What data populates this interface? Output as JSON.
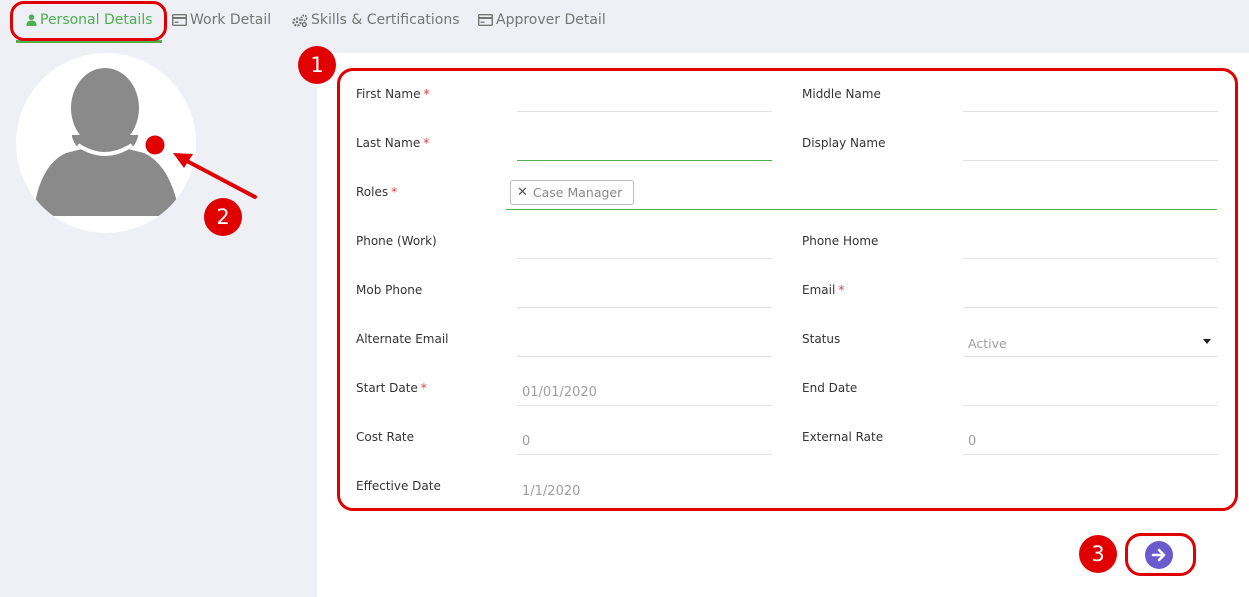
{
  "tabs": [
    {
      "label": "Personal Details",
      "icon": "user-icon",
      "active": true
    },
    {
      "label": "Work Detail",
      "icon": "card-icon"
    },
    {
      "label": "Skills & Certifications",
      "icon": "gears-icon"
    },
    {
      "label": "Approver Detail",
      "icon": "card-icon"
    }
  ],
  "form": {
    "first_name": {
      "label": "First Name",
      "required": "*",
      "value": ""
    },
    "middle_name": {
      "label": "Middle Name",
      "value": ""
    },
    "last_name": {
      "label": "Last Name",
      "required": "*",
      "value": ""
    },
    "display_name": {
      "label": "Display Name",
      "value": ""
    },
    "roles": {
      "label": "Roles",
      "required": "*",
      "chip": "Case Manager",
      "chip_remove": "✕"
    },
    "phone_work": {
      "label": "Phone (Work)",
      "value": ""
    },
    "phone_home": {
      "label": "Phone Home",
      "value": ""
    },
    "mob_phone": {
      "label": "Mob Phone",
      "value": ""
    },
    "email": {
      "label": "Email",
      "required": "*",
      "value": ""
    },
    "alternate_email": {
      "label": "Alternate Email",
      "value": ""
    },
    "status": {
      "label": "Status",
      "value": "Active"
    },
    "start_date": {
      "label": "Start Date",
      "required": "*",
      "value": "01/01/2020"
    },
    "end_date": {
      "label": "End Date",
      "value": ""
    },
    "cost_rate": {
      "label": "Cost Rate",
      "value": "0"
    },
    "external_rate": {
      "label": "External Rate",
      "value": "0"
    },
    "effective_date": {
      "label": "Effective Date",
      "value": "1/1/2020"
    }
  },
  "annotations": {
    "one": "1",
    "two": "2",
    "three": "3"
  },
  "colors": {
    "accent": "#4caf50",
    "annotation": "#e00000",
    "next_button": "#6a5acd",
    "required": "#e53935"
  }
}
